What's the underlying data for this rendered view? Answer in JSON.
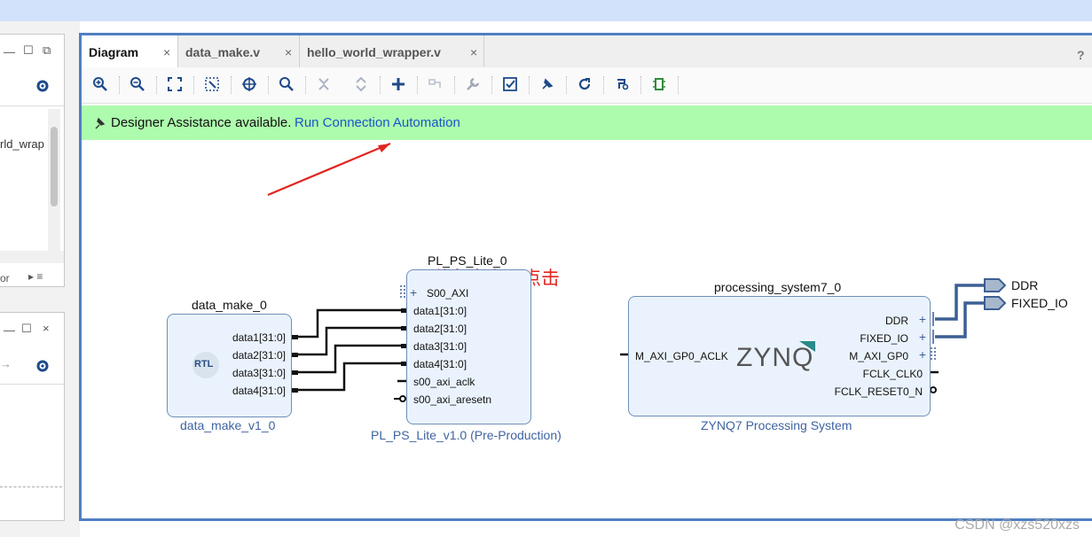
{
  "left_panel": {
    "snippet_text": "rld_wrap",
    "snippet_text2": "or"
  },
  "tabs": [
    {
      "label": "Diagram",
      "active": true
    },
    {
      "label": "data_make.v",
      "active": false
    },
    {
      "label": "hello_world_wrapper.v",
      "active": false
    }
  ],
  "tab_close_glyph": "×",
  "help_glyph": "?",
  "toolbar_icons": [
    "zoom-in-icon",
    "zoom-out-icon",
    "zoom-fit-icon",
    "zoom-area-icon",
    "crosshair-icon",
    "search-icon",
    "collapse-icon",
    "expand-icon",
    "add-ip-icon",
    "make-external-icon",
    "wrench-icon",
    "validate-icon",
    "pin-icon",
    "refresh-icon",
    "optimize-routing-icon",
    "chip-icon"
  ],
  "banner": {
    "message": "Designer Assistance available.",
    "link": "Run Connection Automation"
  },
  "annotation": "弹出这个，点击",
  "blocks": {
    "data_make": {
      "instance": "data_make_0",
      "type": "data_make_v1_0",
      "logo": "RTL",
      "ports": [
        "data1[31:0]",
        "data2[31:0]",
        "data3[31:0]",
        "data4[31:0]"
      ]
    },
    "pl_ps_lite": {
      "instance": "PL_PS_Lite_0",
      "type": "PL_PS_Lite_v1.0 (Pre-Production)",
      "bus_port": "S00_AXI",
      "ports": [
        "data1[31:0]",
        "data2[31:0]",
        "data3[31:0]",
        "data4[31:0]",
        "s00_axi_aclk",
        "s00_axi_aresetn"
      ]
    },
    "ps7": {
      "instance": "processing_system7_0",
      "type": "ZYNQ7 Processing System",
      "logo": "ZYNQ",
      "input_port": "M_AXI_GP0_ACLK",
      "output_ports": [
        "DDR",
        "FIXED_IO",
        "M_AXI_GP0",
        "FCLK_CLK0",
        "FCLK_RESET0_N"
      ]
    }
  },
  "external_ports": [
    "DDR",
    "FIXED_IO"
  ],
  "watermark": "CSDN @xzs520xzs",
  "colors": {
    "banner": "#adfcad",
    "link": "#1a55c9",
    "block_fill": "#eaf3fd",
    "block_border": "#6f8fb8",
    "accent_frame": "#4f7fc2",
    "annotation": "#e0261f",
    "bus_line": "#3d5f94"
  }
}
